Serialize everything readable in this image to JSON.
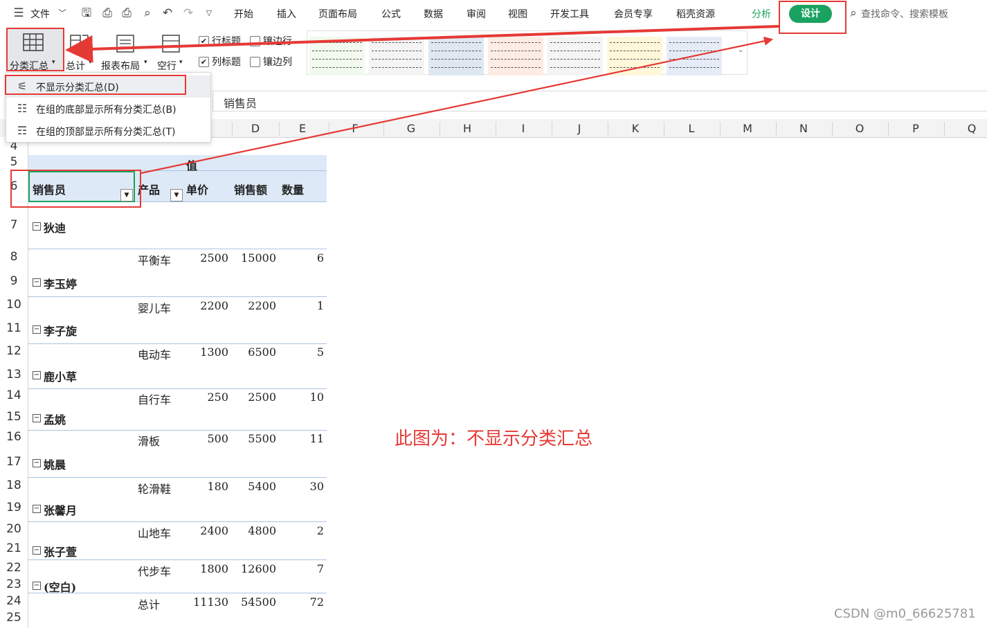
{
  "menubar": {
    "file_label": "文件",
    "tabs": [
      "开始",
      "插入",
      "页面布局",
      "公式",
      "数据",
      "审阅",
      "视图",
      "开发工具",
      "会员专享",
      "稻壳资源",
      "分析",
      "设计"
    ],
    "search_placeholder": "查找命令、搜索模板"
  },
  "ribbon": {
    "subtotal_label": "分类汇总",
    "grandtotal_label": "总计",
    "layout_label": "报表布局",
    "blankrow_label": "空行",
    "row_header_label": "行标题",
    "banded_rows_label": "镶边行",
    "col_header_label": "列标题",
    "banded_cols_label": "镶边列",
    "row_header_checked": true,
    "col_header_checked": true,
    "banded_rows_checked": false,
    "banded_cols_checked": false,
    "style_colors": [
      "#f2f9ee",
      "#f4f4f4",
      "#dfe8f2",
      "#fdece4",
      "#f4f4f4",
      "#fff7d9",
      "#e6ecf7"
    ]
  },
  "dropdown": {
    "items": [
      {
        "label": "不显示分类汇总(D)",
        "icon": "no-subtotal-icon"
      },
      {
        "label": "在组的底部显示所有分类汇总(B)",
        "icon": "subtotal-bottom-icon"
      },
      {
        "label": "在组的顶部显示所有分类汇总(T)",
        "icon": "subtotal-top-icon"
      }
    ]
  },
  "formula_bar": {
    "value": "销售员"
  },
  "columns": [
    "C",
    "D",
    "E",
    "F",
    "G",
    "H",
    "I",
    "J",
    "K",
    "L",
    "M",
    "N",
    "O",
    "P",
    "Q"
  ],
  "rows": [
    "4",
    "5",
    "6",
    "7",
    "8",
    "9",
    "10",
    "11",
    "12",
    "13",
    "14",
    "15",
    "16",
    "17",
    "18",
    "19",
    "20",
    "21",
    "22",
    "23",
    "24",
    "25"
  ],
  "pivot": {
    "values_header": "值",
    "field_salesperson": "销售员",
    "field_product": "产品",
    "col_price": "单价",
    "col_sales": "销售额",
    "col_qty": "数量",
    "groups": [
      {
        "name": "狄迪",
        "product": "平衡车",
        "price": "2500",
        "sales": "15000",
        "qty": "6"
      },
      {
        "name": "李玉婷",
        "product": "婴儿车",
        "price": "2200",
        "sales": "2200",
        "qty": "1"
      },
      {
        "name": "李子旋",
        "product": "电动车",
        "price": "1300",
        "sales": "6500",
        "qty": "5"
      },
      {
        "name": "鹿小草",
        "product": "自行车",
        "price": "250",
        "sales": "2500",
        "qty": "10"
      },
      {
        "name": "孟姚",
        "product": "滑板",
        "price": "500",
        "sales": "5500",
        "qty": "11"
      },
      {
        "name": "姚晨",
        "product": "轮滑鞋",
        "price": "180",
        "sales": "5400",
        "qty": "30"
      },
      {
        "name": "张馨月",
        "product": "山地车",
        "price": "2400",
        "sales": "4800",
        "qty": "2"
      },
      {
        "name": "张子萱",
        "product": "代步车",
        "price": "1800",
        "sales": "12600",
        "qty": "7"
      },
      {
        "name": "(空白)",
        "product": "",
        "price": "",
        "sales": "",
        "qty": ""
      }
    ],
    "total_label": "总计",
    "total_price": "11130",
    "total_sales": "54500",
    "total_qty": "72"
  },
  "annotation": "此图为：不显示分类汇总",
  "watermark": "CSDN @m0_66625781",
  "accent_color": "#1aa260",
  "highlight_color": "#e53935"
}
